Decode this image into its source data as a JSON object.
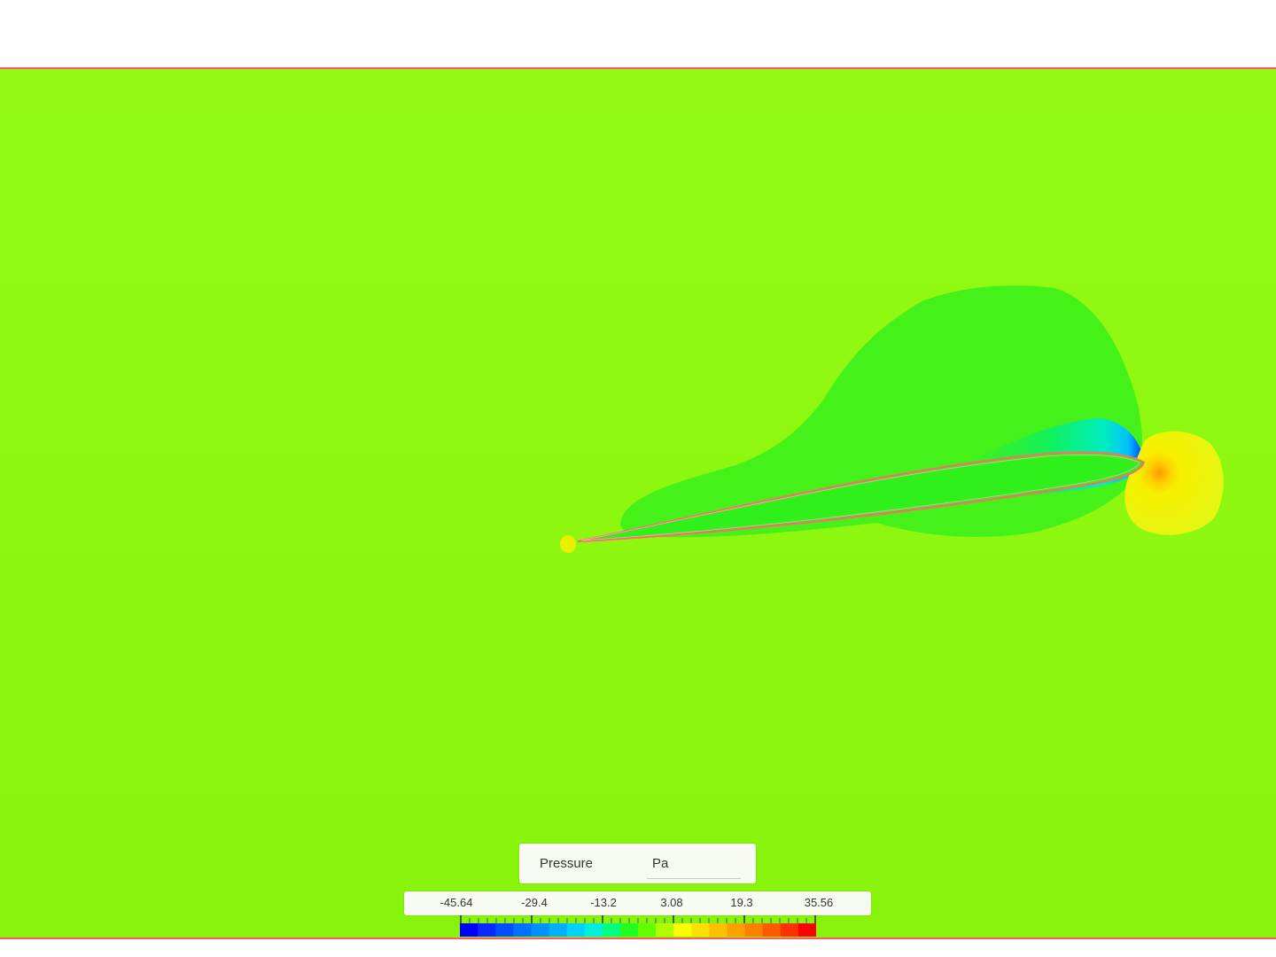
{
  "scene": {
    "background_color": "#8af70c",
    "frame_color": "#ff3b3b",
    "page_color": "#ffffff"
  },
  "legend": {
    "title": "Pressure",
    "unit": "Pa",
    "ticks": [
      "-45.64",
      "-29.4",
      "-13.2",
      "3.08",
      "19.3",
      "35.56"
    ],
    "range": [
      -45.64,
      35.56
    ],
    "colors": [
      "#0000ff",
      "#0a28ff",
      "#0050ff",
      "#0070ff",
      "#0090ff",
      "#00b0ff",
      "#00d0ff",
      "#00eee0",
      "#00ff80",
      "#20ff20",
      "#60ff00",
      "#b0ff00",
      "#ffff00",
      "#ffe000",
      "#ffc000",
      "#ffa000",
      "#ff8000",
      "#ff5a00",
      "#ff3000",
      "#ff0000"
    ]
  }
}
